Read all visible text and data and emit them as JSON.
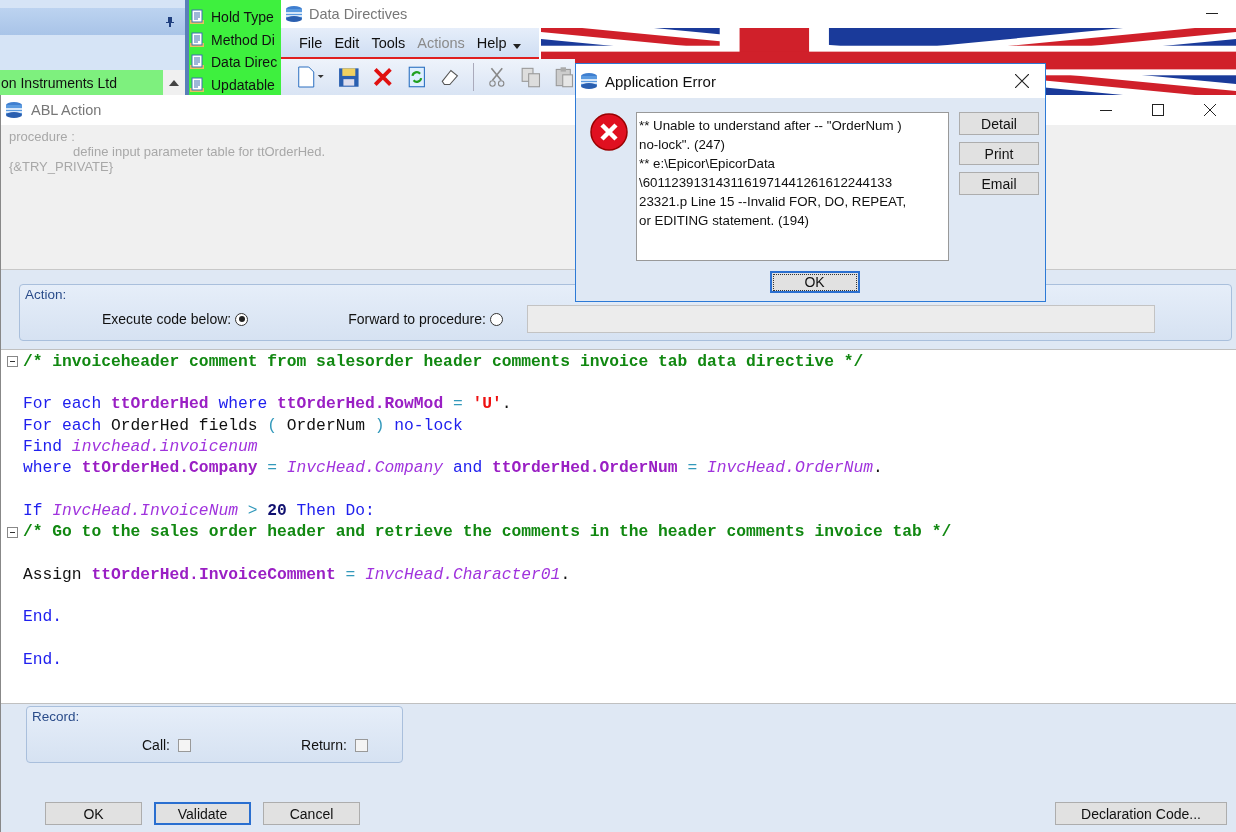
{
  "background_app": {
    "header_row": "on Instruments Ltd",
    "list_items": [
      "Hold Type",
      "Method Di",
      "Data Direc",
      "Updatable"
    ]
  },
  "data_directives_window": {
    "title": "Data Directives",
    "menu": [
      {
        "label": "File",
        "disabled": false
      },
      {
        "label": "Edit",
        "disabled": false
      },
      {
        "label": "Tools",
        "disabled": false
      },
      {
        "label": "Actions",
        "disabled": true
      },
      {
        "label": "Help",
        "disabled": false
      }
    ]
  },
  "abl_action_window": {
    "title": "ABL Action",
    "procedure_text": [
      {
        "text": "procedure :",
        "children": [
          {
            "text": "define input parameter table for ttOrderHed."
          }
        ]
      },
      {
        "text": "{&TRY_PRIVATE}"
      }
    ],
    "action": {
      "title": "Action:",
      "options": [
        {
          "label": "Execute code below:",
          "selected": true
        },
        {
          "label": "Forward to procedure:",
          "selected": false
        }
      ]
    },
    "code_lines": [
      {
        "fold": true,
        "tokens": [
          {
            "kind": "comment",
            "text": "/* invoiceheader comment from salesorder header comments invoice tab data directive */"
          }
        ]
      },
      {
        "fold": false
      },
      {
        "fold": false,
        "tokens": [
          {
            "kind": "keyword",
            "text": "For each "
          },
          {
            "kind": "table",
            "text": "ttOrderHed"
          },
          {
            "kind": "keyword",
            "text": " where "
          },
          {
            "kind": "table",
            "text": "ttOrderHed.RowMod"
          },
          {
            "kind": "op",
            "text": " = "
          },
          {
            "kind": "string",
            "text": "'U'"
          },
          {
            "kind": "plain",
            "text": "."
          }
        ]
      },
      {
        "fold": false,
        "tokens": [
          {
            "kind": "keyword",
            "text": "For each "
          },
          {
            "kind": "plain",
            "text": "OrderHed fields "
          },
          {
            "kind": "op",
            "text": "( "
          },
          {
            "kind": "plain",
            "text": "OrderNum "
          },
          {
            "kind": "op",
            "text": ") "
          },
          {
            "kind": "keyword",
            "text": "no-lock"
          }
        ]
      },
      {
        "fold": false,
        "tokens": [
          {
            "kind": "keyword",
            "text": "Find "
          },
          {
            "kind": "field",
            "text": "invchead.invoicenum"
          }
        ]
      },
      {
        "fold": false,
        "tokens": [
          {
            "kind": "keyword",
            "text": "where "
          },
          {
            "kind": "table",
            "text": "ttOrderHed.Company"
          },
          {
            "kind": "op",
            "text": " = "
          },
          {
            "kind": "field",
            "text": "InvcHead.Company"
          },
          {
            "kind": "keyword",
            "text": " and "
          },
          {
            "kind": "table",
            "text": "ttOrderHed.OrderNum"
          },
          {
            "kind": "op",
            "text": " = "
          },
          {
            "kind": "field",
            "text": "InvcHead.OrderNum"
          },
          {
            "kind": "plain",
            "text": "."
          }
        ]
      },
      {
        "fold": false
      },
      {
        "fold": false,
        "tokens": [
          {
            "kind": "keyword",
            "text": "If "
          },
          {
            "kind": "field",
            "text": "InvcHead.InvoiceNum"
          },
          {
            "kind": "op",
            "text": " > "
          },
          {
            "kind": "number",
            "text": "20"
          },
          {
            "kind": "keyword",
            "text": " Then Do:"
          }
        ]
      },
      {
        "fold": true,
        "tokens": [
          {
            "kind": "comment",
            "text": "/* Go to the sales order header and retrieve the comments in the header comments invoice tab */"
          }
        ]
      },
      {
        "fold": false
      },
      {
        "fold": false,
        "tokens": [
          {
            "kind": "plain",
            "text": "Assign "
          },
          {
            "kind": "table",
            "text": "ttOrderHed.InvoiceComment"
          },
          {
            "kind": "op",
            "text": " = "
          },
          {
            "kind": "field",
            "text": "InvcHead.Character01"
          },
          {
            "kind": "plain",
            "text": "."
          }
        ]
      },
      {
        "fold": false
      },
      {
        "fold": false,
        "tokens": [
          {
            "kind": "keyword",
            "text": "End."
          }
        ]
      },
      {
        "fold": false
      },
      {
        "fold": false,
        "tokens": [
          {
            "kind": "keyword",
            "text": "End."
          }
        ]
      }
    ],
    "record": {
      "title": "Record:",
      "options": [
        {
          "label": "Call:",
          "checked": false
        },
        {
          "label": "Return:",
          "checked": false
        }
      ]
    },
    "buttons": [
      {
        "label": "OK",
        "focused": false
      },
      {
        "label": "Validate",
        "focused": true
      },
      {
        "label": "Cancel",
        "focused": false
      }
    ],
    "declaration_button": "Declaration Code..."
  },
  "error_dialog": {
    "title": "Application Error",
    "message_lines": [
      "** Unable to understand after -- \"OrderNum )",
      "no-lock\". (247)",
      "** e:\\Epicor\\EpicorData",
      "\\6011239131431161971441261612244133",
      "23321.p Line 15 --Invalid FOR, DO, REPEAT,",
      "or EDITING statement. (194)"
    ],
    "side_buttons": [
      "Detail",
      "Print",
      "Email"
    ],
    "ok_button": "OK"
  }
}
